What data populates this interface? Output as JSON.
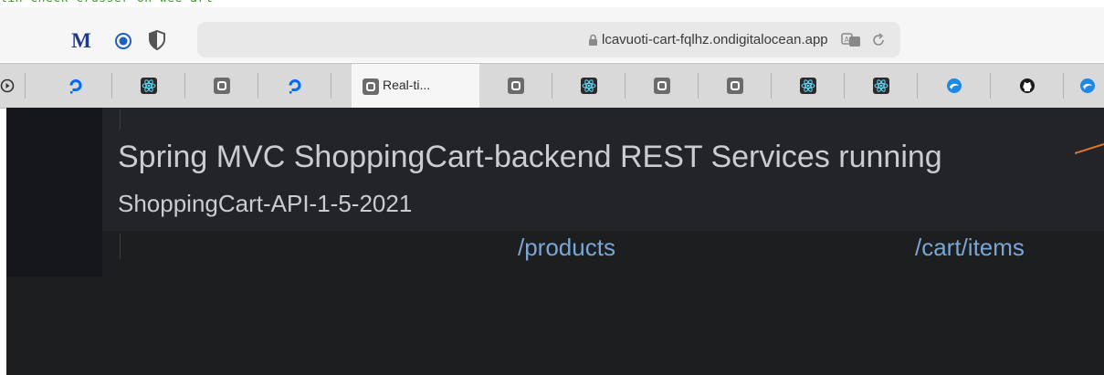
{
  "caption": "lin-check-crusser-on-wee-arl",
  "toolbar": {
    "extensions": [
      {
        "icon": "medium-m-icon",
        "label": "M"
      },
      {
        "icon": "target-circle-icon"
      },
      {
        "icon": "shield-half-icon"
      }
    ],
    "address": {
      "url": "lcavuoti-cart-fqlhz.ondigitalocean.app",
      "lock_icon": "lock-icon",
      "translate_icon": "translate-icon",
      "reload_icon": "reload-icon"
    }
  },
  "tabs": [
    {
      "icon": "play-circle-icon"
    },
    {
      "icon": "digitalocean-icon"
    },
    {
      "icon": "react-icon"
    },
    {
      "icon": "square-o-icon"
    },
    {
      "icon": "digitalocean-icon"
    },
    {
      "icon": "square-o-icon",
      "title": "Real-ti...",
      "active": true
    },
    {
      "icon": "square-o-icon"
    },
    {
      "icon": "react-icon"
    },
    {
      "icon": "square-o-icon"
    },
    {
      "icon": "square-o-icon"
    },
    {
      "icon": "react-icon"
    },
    {
      "icon": "react-icon"
    },
    {
      "icon": "blue-swirl-icon"
    },
    {
      "icon": "github-icon"
    },
    {
      "icon": "blue-swirl-icon"
    }
  ],
  "page": {
    "headline": "Spring MVC ShoppingCart-backend REST Services running",
    "subtitle": "ShoppingCart-API-1-5-2021",
    "links": {
      "products": "/products",
      "cart_items": "/cart/items"
    }
  },
  "colors": {
    "page_bg": "#1d1e20",
    "text": "#c9ccd1",
    "link": "#7aa6d6",
    "accent_orange": "#e2742a"
  }
}
